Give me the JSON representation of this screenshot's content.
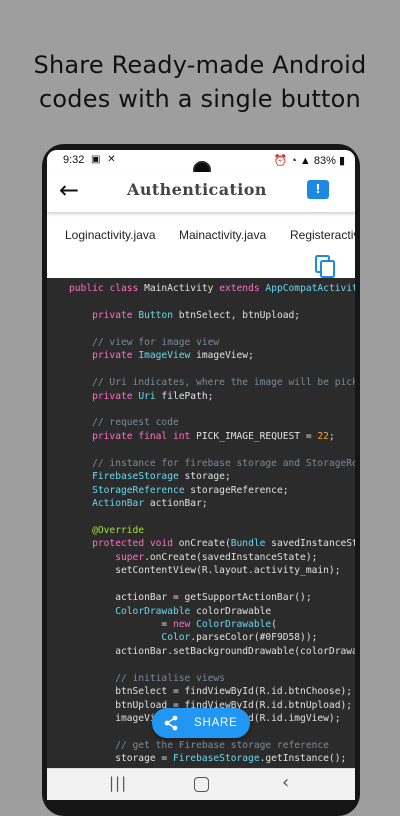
{
  "headline": {
    "line1": "Share Ready-made Android",
    "line2": "codes with a single button"
  },
  "status_bar": {
    "time": "9:32",
    "left_icons": "▣ ✕",
    "battery": "83%",
    "right_icons": "⏰ ◔ ▲"
  },
  "app_bar": {
    "back_glyph": "←",
    "title": "Authentication",
    "action_glyph": "!"
  },
  "tabs": [
    {
      "label": "Loginactivity.java"
    },
    {
      "label": "Mainactivity.java"
    },
    {
      "label": "Registeractivity.java"
    }
  ],
  "code": {
    "lines": [
      "public class MainActivity extends AppCompatActivity {",
      "",
      "    private Button btnSelect, btnUpload;",
      "",
      "    // view for image view",
      "    private ImageView imageView;",
      "",
      "    // Uri indicates, where the image will be picked from",
      "    private Uri filePath;",
      "",
      "    // request code",
      "    private final int PICK_IMAGE_REQUEST = 22;",
      "",
      "    // instance for firebase storage and StorageReference",
      "    FirebaseStorage storage;",
      "    StorageReference storageReference;",
      "    ActionBar actionBar;",
      "",
      "    @Override",
      "    protected void onCreate(Bundle savedInstanceState) {",
      "        super.onCreate(savedInstanceState);",
      "        setContentView(R.layout.activity_main);",
      "",
      "        actionBar = getSupportActionBar();",
      "        ColorDrawable colorDrawable",
      "                = new ColorDrawable(",
      "                Color.parseColor(#0F9D58));",
      "        actionBar.setBackgroundDrawable(colorDrawable);",
      "",
      "        // initialise views",
      "        btnSelect = findViewById(R.id.btnChoose);",
      "        btnUpload = findViewById(R.id.btnUpload);",
      "        imageView = findViewById(R.id.imgView);",
      "",
      "        // get the Firebase storage reference",
      "        storage = FirebaseStorage.getInstance();"
    ]
  },
  "share_button": {
    "label": "SHARE"
  },
  "nav_bar": {
    "recent_glyph": "|||",
    "back_glyph": "‹"
  },
  "colors": {
    "accent": "#2196f3",
    "code_background": "#2b2b2b",
    "keyword": "#ff6ec7",
    "type": "#66d9ef",
    "comment": "#7a8a9a",
    "annotation": "#a6e22e"
  }
}
